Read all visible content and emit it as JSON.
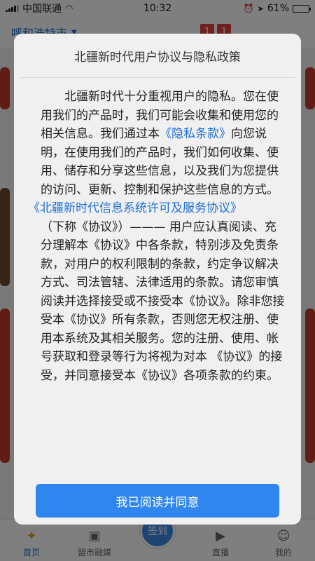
{
  "status_bar": {
    "carrier": "中国联通",
    "time": "10:32",
    "battery": "61%",
    "battery_level": 0.61
  },
  "app": {
    "city": "呼和浩特市",
    "header_tiles": [
      "1",
      "1"
    ],
    "tabs": [
      {
        "label": "首页",
        "icon": "home-icon"
      },
      {
        "label": "盟市融媒",
        "icon": "media-icon"
      },
      {
        "label": "签到",
        "icon": "checkin-icon"
      },
      {
        "label": "直播",
        "icon": "live-icon"
      },
      {
        "label": "我的",
        "icon": "profile-icon"
      }
    ]
  },
  "modal": {
    "title": "北疆新时代用户协议与隐私政策",
    "p1_a": "北疆新时代十分重视用户的隐私。您在使用我们的产品时，我们可能会收集和使用您的相关信息。我们通过本",
    "privacy_link": "《隐私条款》",
    "p1_b": "向您说明，在使用我们的产品时，我们如何收集、使用、储存和分享这些信息，以及我们为您提供的访问、更新、控制和保护这些信息的方式。",
    "agreement_link": "《北疆新时代信息系统许可及服务协议》",
    "p2": "（下称《协议》）——— 用户应认真阅读、充分理解本《协议》中各条款，特别涉及免责条款，对用户的权利限制的条款，约定争议解决方式、司法管辖、法律适用的条款。请您审慎阅读并选择接受或不接受本《协议》。除非您接受本《协议》所有条款，否则您无权注册、使用本系统及其相关服务。您的注册、使用、帐号获取和登录等行为将视为对本 《协议》的接受，并同意接受本《协议》各项条款的约束。",
    "agree_label": "我已阅读并同意"
  },
  "colors": {
    "accent": "#2f86ee",
    "link": "#1d6fd8"
  }
}
